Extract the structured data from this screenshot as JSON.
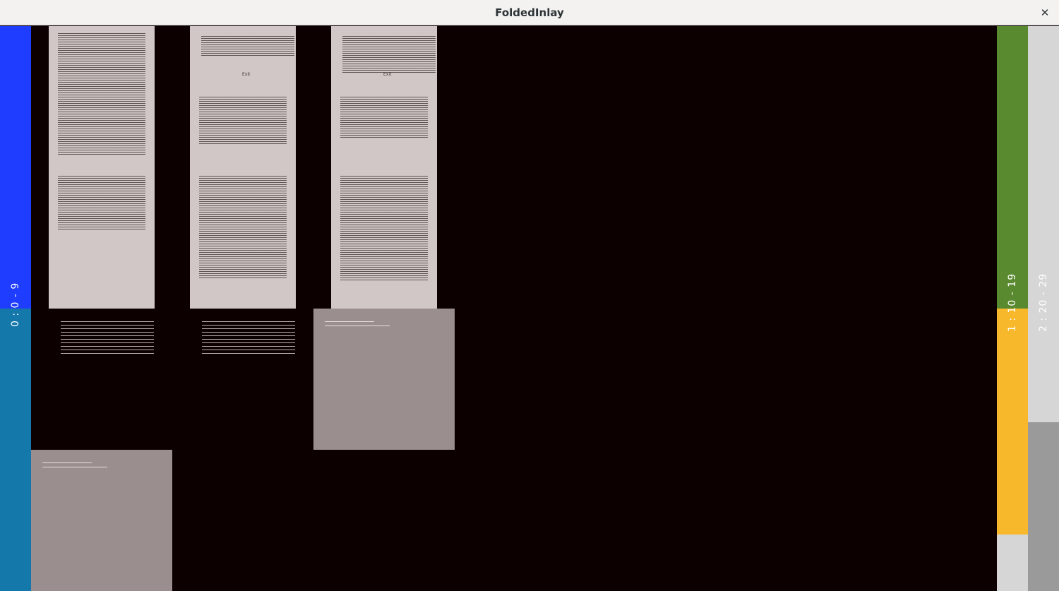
{
  "window": {
    "title": "FoldedInlay",
    "close_label": "✕"
  },
  "bars": {
    "left": {
      "label": "0 : 0 - 9",
      "top_color": "#1f3dff",
      "bottom_color": "#1478aa"
    },
    "right_a": {
      "label": "1 : 10 - 19",
      "top_color": "#5a8a30",
      "bottom_color": "#f7b92b",
      "tail_color": "#d6d6d6"
    },
    "right_b": {
      "label": "2 : 20 - 29",
      "top_color": "#d6d6d6",
      "bottom_color": "#9a9a9a"
    }
  },
  "canvas": {
    "background": "#0c0000",
    "page_color": "#d2c7c7",
    "tile_color": "#9a8e8e"
  },
  "pages": [
    {
      "heading": ""
    },
    {
      "heading": "Exit"
    },
    {
      "heading": "Exit"
    }
  ]
}
